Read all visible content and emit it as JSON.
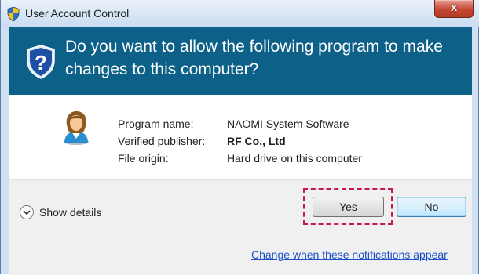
{
  "window": {
    "title": "User Account Control",
    "close_label": "x"
  },
  "banner": {
    "question": "Do you want to allow the following program to make changes to this computer?"
  },
  "program_info": {
    "name_label": "Program name:",
    "name_value": "NAOMI System Software",
    "publisher_label": "Verified publisher:",
    "publisher_value": "RF Co., Ltd",
    "origin_label": "File origin:",
    "origin_value": "Hard drive on this computer"
  },
  "footer": {
    "show_details_label": "Show details",
    "yes_label": "Yes",
    "no_label": "No",
    "notifications_link": "Change when these notifications appear"
  },
  "icons": {
    "title": "uac-shield-icon",
    "banner": "uac-shield-question-icon",
    "program": "user-icon",
    "details": "chevron-down-icon"
  },
  "colors": {
    "banner_bg": "#0d6087",
    "link": "#1a4fc5",
    "highlight": "#c8174a",
    "close_button": "#c54733"
  }
}
